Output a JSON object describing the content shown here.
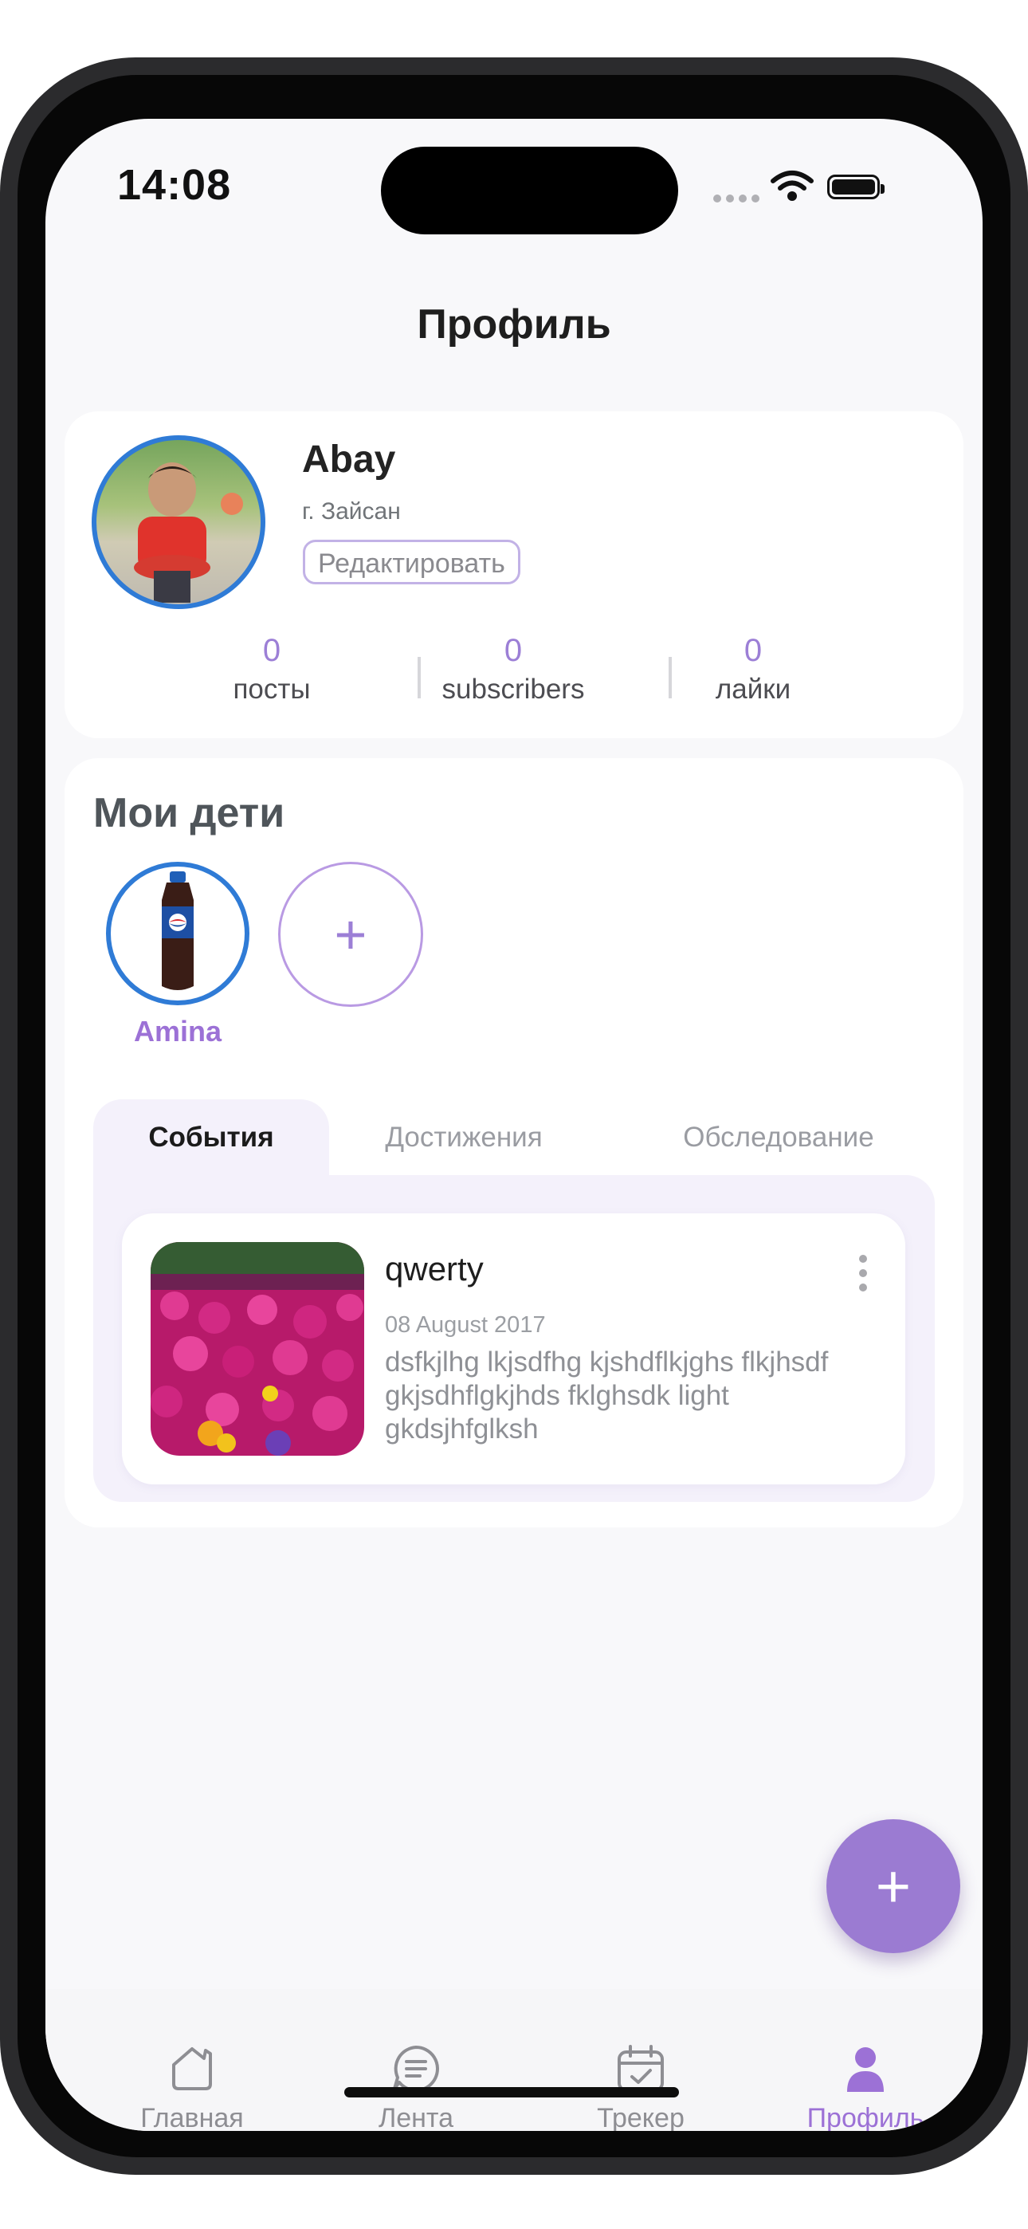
{
  "status_bar": {
    "time": "14:08"
  },
  "header": {
    "title": "Профиль"
  },
  "profile": {
    "name": "Abay",
    "city": "г. Зайсан",
    "edit_label": "Редактировать",
    "stats": [
      {
        "value": "0",
        "label": "посты"
      },
      {
        "value": "0",
        "label": "subscribers"
      },
      {
        "value": "0",
        "label": "лайки"
      }
    ]
  },
  "kids": {
    "title": "Мои дети",
    "children": [
      {
        "name": "Amina"
      }
    ],
    "add_label": "+"
  },
  "tabs": [
    {
      "label": "События",
      "active": true
    },
    {
      "label": "Достижения",
      "active": false
    },
    {
      "label": "Обследование",
      "active": false
    }
  ],
  "events": [
    {
      "title": "qwerty",
      "date": "08 August 2017",
      "text": "dsfkjlhg lkjsdfhg kjshdflkjghs flkjhsdf gkjsdhflgkjhds fklghsdk light gkdsjhfglksh"
    }
  ],
  "fab_label": "+",
  "nav": [
    {
      "label": "Главная",
      "icon": "home-icon",
      "active": false
    },
    {
      "label": "Лента",
      "icon": "feed-icon",
      "active": false
    },
    {
      "label": "Трекер",
      "icon": "calendar-check-icon",
      "active": false
    },
    {
      "label": "Профиль",
      "icon": "profile-icon",
      "active": true
    }
  ],
  "colors": {
    "accent": "#9b7bd2",
    "avatar_ring": "#2f7bd6"
  }
}
